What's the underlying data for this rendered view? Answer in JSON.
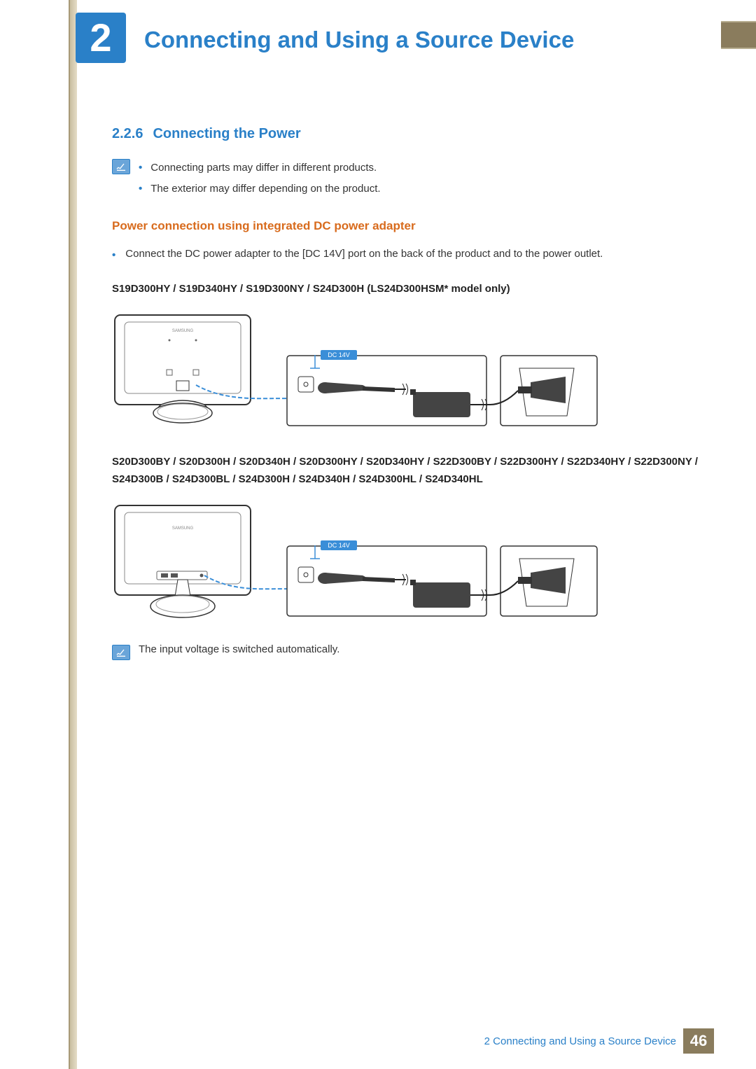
{
  "header": {
    "chapter_number": "2",
    "chapter_title": "Connecting and Using a Source Device"
  },
  "section": {
    "number": "2.2.6",
    "title": "Connecting the Power"
  },
  "note1": {
    "line1": "Connecting parts may differ in different products.",
    "line2": "The exterior may differ depending on the product."
  },
  "subheading": "Power connection using integrated DC power adapter",
  "instruction": "Connect the DC power adapter to the [DC 14V] port on the back of the product and to the power outlet.",
  "model_list_1": "S19D300HY / S19D340HY / S19D300NY / S24D300H (LS24D300HSM* model only)",
  "model_list_2": "S20D300BY / S20D300H / S20D340H / S20D300HY / S20D340HY / S22D300BY / S22D300HY / S22D340HY / S22D300NY / S24D300B / S24D300BL / S24D300H / S24D340H / S24D300HL / S24D340HL",
  "diagram_label": "DC 14V",
  "brand_label": "SAMSUNG",
  "footnote": "The input voltage is switched automatically.",
  "footer": {
    "chapter_ref_num": "2",
    "chapter_ref_title": "Connecting and Using a Source Device",
    "page": "46"
  }
}
